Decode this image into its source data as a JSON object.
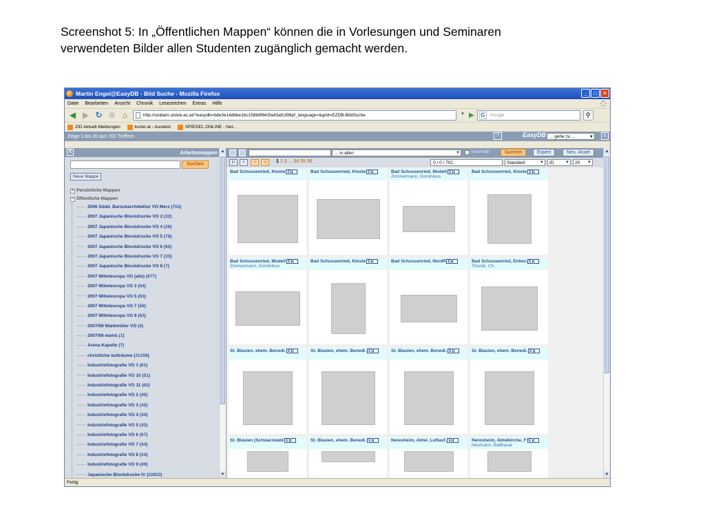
{
  "caption": {
    "line1": "Screenshot 5: In „Öffentlichen Mappen“ können die in Vorlesungen und Seminaren",
    "line2": "verwendeten Bilder allen Studenten zugänglich gemacht werden."
  },
  "window": {
    "title": "Martin Engel@EasyDB - Bild Suche - Mozilla Firefox",
    "menu": [
      "Datei",
      "Bearbeiten",
      "Ansicht",
      "Chronik",
      "Lesezeichen",
      "Extras",
      "Hilfe"
    ],
    "url": "http://unidam.univie.ac.at/?easydb=bde3e14dbbe1bc158b8f843fa43afc398pf_language=&grid=EZDB-BildSuche",
    "search_placeholder": "Google",
    "bookmarks": [
      "ZID Aktuell-Meldungen",
      "kurier.at - Ausland",
      "SPIEGEL ONLINE - Net..."
    ],
    "status": "Fertig"
  },
  "app": {
    "result_count": "Zeige 1 bis 20 aus 702 Treffern.",
    "help": "?",
    "logo": "EasyDB",
    "goto": "... gehe zu ...",
    "close": "X"
  },
  "leftpane": {
    "close": "X",
    "title": "Arbeitsmappen",
    "search_button": "Suchen",
    "new_folder": "Neue Mappe",
    "root_personal": "Persönliche Mappen",
    "root_public": "Öffentliche Mappen",
    "folders": [
      {
        "name": "2006 Südd. Barockarchitektur VO Merz",
        "count": "702"
      },
      {
        "name": "2007 Japanische Blockdrucke VO 2",
        "count": "32"
      },
      {
        "name": "2007 Japanische Blockdrucke VO 4",
        "count": "26"
      },
      {
        "name": "2007 Japanische Blockdrucke VO 5",
        "count": "78"
      },
      {
        "name": "2007 Japanische Blockdrucke VO 6",
        "count": "65"
      },
      {
        "name": "2007 Japanische Blockdrucke VO 7",
        "count": "33"
      },
      {
        "name": "2007 Japanische Blockdrucke VO 8",
        "count": "7"
      },
      {
        "name": "2007 Mitteleuropa VO (alle)",
        "count": "677"
      },
      {
        "name": "2007 Mitteleuropa VO 3",
        "count": "54"
      },
      {
        "name": "2007 Mitteleuropa VO 5",
        "count": "63"
      },
      {
        "name": "2007 Mitteleuropa VO 7",
        "count": "56"
      },
      {
        "name": "2007 Mitteleuropa VO 8",
        "count": "63"
      },
      {
        "name": "2007/08 Waldmüller VO",
        "count": "4"
      },
      {
        "name": "2007/08 wamü",
        "count": "1"
      },
      {
        "name": "Arena Kapelle",
        "count": "7"
      },
      {
        "name": "christliche kulträume",
        "count": "31258"
      },
      {
        "name": "Industriefotografie VO 1",
        "count": "61"
      },
      {
        "name": "Industriefotografie VO 10",
        "count": "51"
      },
      {
        "name": "Industriefotografie VO 11",
        "count": "62"
      },
      {
        "name": "Industriefotografie VO 2",
        "count": "40"
      },
      {
        "name": "Industriefotografie VO 3",
        "count": "42"
      },
      {
        "name": "Industriefotografie VO 4",
        "count": "34"
      },
      {
        "name": "Industriefotografie VO 5",
        "count": "42"
      },
      {
        "name": "Industriefotografie VO 6",
        "count": "67"
      },
      {
        "name": "Industriefotografie VO 7",
        "count": "44"
      },
      {
        "name": "Industriefotografie VO 8",
        "count": "24"
      },
      {
        "name": "Industriefotografie VO 9",
        "count": "49"
      },
      {
        "name": "Japanische Blockdrucke IV",
        "count": "22823"
      }
    ]
  },
  "toolbar": {
    "scope": "... in allen",
    "within": "innerhalb",
    "search": "Suchen",
    "expert": "Expert",
    "new_asset": "Neu. Asset"
  },
  "pager": {
    "first": "|<",
    "prev": "<",
    "next": ">",
    "last": ">|",
    "current": "1",
    "pages": "2 3 ... 34 35 36",
    "counter": "0 / 0 / 702",
    "view": "Standard",
    "sort": "ID",
    "per_page": "20"
  },
  "results": [
    {
      "title": "Bad Schussenried, Kloste",
      "sub": ""
    },
    {
      "title": "Bad Schussenried, Kloste",
      "sub": ""
    },
    {
      "title": "Bad Schussenried, Modell",
      "sub": "Zimmermann, Dominikus"
    },
    {
      "title": "Bad Schussenried, Kloste",
      "sub": ""
    },
    {
      "title": "Bad Schussenried, Modell",
      "sub": "Zimmermann, Dominikus"
    },
    {
      "title": "Bad Schussenried, Kloste",
      "sub": ""
    },
    {
      "title": "Bad Schussenried, Nordfl",
      "sub": ""
    },
    {
      "title": "Bad Schussenried, Entwu",
      "sub": "Thumb, Ch."
    },
    {
      "title": "St. Blasien, ehem. Benedi.",
      "sub": ""
    },
    {
      "title": "St. Blasien, ehem. Benedi.",
      "sub": ""
    },
    {
      "title": "St. Blasien, ehem. Benedi.",
      "sub": ""
    },
    {
      "title": "St. Blasien, ehem. Benedi.",
      "sub": ""
    },
    {
      "title": "St. Blasien (Schwarzwald",
      "sub": ""
    },
    {
      "title": "St. Blasien, ehem. Benedi.",
      "sub": ""
    },
    {
      "title": "Neresheim, Abtei, Luftauf.",
      "sub": ""
    },
    {
      "title": "Neresheim, Abteikirche, F",
      "sub": "Neumann, Balthasar"
    }
  ],
  "badge_e": "E"
}
